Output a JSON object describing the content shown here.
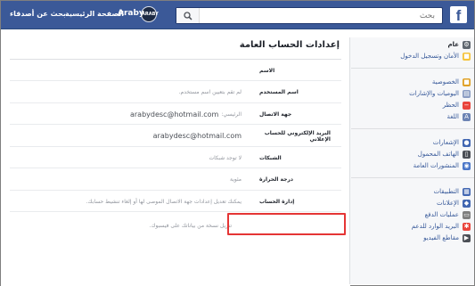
{
  "topbar": {
    "logo": "f",
    "search_placeholder": "بحث",
    "user_name": "Araby",
    "avatar_text": "ARABY",
    "home_label": "الصفحة الرئيسية",
    "friends_label": "بحث عن أصدقاء"
  },
  "sidebar": {
    "groups": [
      [
        {
          "label": "عام",
          "icon": "gear-icon",
          "color": "#606770",
          "active": true
        },
        {
          "label": "الأمان وتسجيل الدخول",
          "icon": "shield-icon",
          "color": "#f5c33b",
          "active": false
        }
      ],
      [
        {
          "label": "الخصوصية",
          "icon": "lock-icon",
          "color": "#e0a126",
          "active": false
        },
        {
          "label": "اليوميات والإشارات",
          "icon": "timeline-icon",
          "color": "#8b9dc3",
          "active": false
        },
        {
          "label": "الحظر",
          "icon": "block-icon",
          "color": "#e9453c",
          "active": false
        },
        {
          "label": "اللغة",
          "icon": "language-icon",
          "color": "#6d84b4",
          "active": false
        }
      ],
      [
        {
          "label": "الإشعارات",
          "icon": "globe-icon",
          "color": "#4267b2",
          "active": false
        },
        {
          "label": "الهاتف المحمول",
          "icon": "mobile-icon",
          "color": "#4b4f56",
          "active": false
        },
        {
          "label": "المنشورات العامة",
          "icon": "rss-icon",
          "color": "#4a76c8",
          "active": false
        }
      ],
      [
        {
          "label": "التطبيقات",
          "icon": "apps-icon",
          "color": "#4267b2",
          "active": false
        },
        {
          "label": "الإعلانات",
          "icon": "ads-icon",
          "color": "#4267b2",
          "active": false
        },
        {
          "label": "عمليات الدفع",
          "icon": "payments-icon",
          "color": "#7f7f7f",
          "active": false
        },
        {
          "label": "البريد الوارد للدعم",
          "icon": "lifebuoy-icon",
          "color": "#e9453c",
          "active": false
        },
        {
          "label": "مقاطع الفيديو",
          "icon": "video-icon",
          "color": "#4b4f56",
          "active": false
        }
      ]
    ]
  },
  "main": {
    "title": "إعدادات الحساب العامة",
    "rows": [
      {
        "label": "الاسم",
        "value": "",
        "prefix": "",
        "email": ""
      },
      {
        "label": "اسم المستخدم",
        "value": "لم تقم بتعيين اسم مستخدم.",
        "prefix": "",
        "email": ""
      },
      {
        "label": "جهة الاتصال",
        "value": "",
        "prefix": "الرئيسي:",
        "email": "arabydesc@hotmail.com"
      },
      {
        "label": "البريد الإلكتروني للحساب الإعلاني",
        "value": "",
        "prefix": "",
        "email": "arabydesc@hotmail.com"
      },
      {
        "label": "الشبكات",
        "value": "لا توجد شبكات",
        "prefix": "",
        "email": ""
      },
      {
        "label": "درجة الحرارة",
        "value": "مئوية",
        "prefix": "",
        "email": ""
      },
      {
        "label": "إدارة الحساب",
        "value": "يمكنك تعديل إعدادات جهة الاتصال الموصى لها أو إلغاء تنشيط حسابك.",
        "prefix": "",
        "email": ""
      }
    ],
    "download_link": "تنزيل نسخة من بياناتك على فيسبوك."
  }
}
